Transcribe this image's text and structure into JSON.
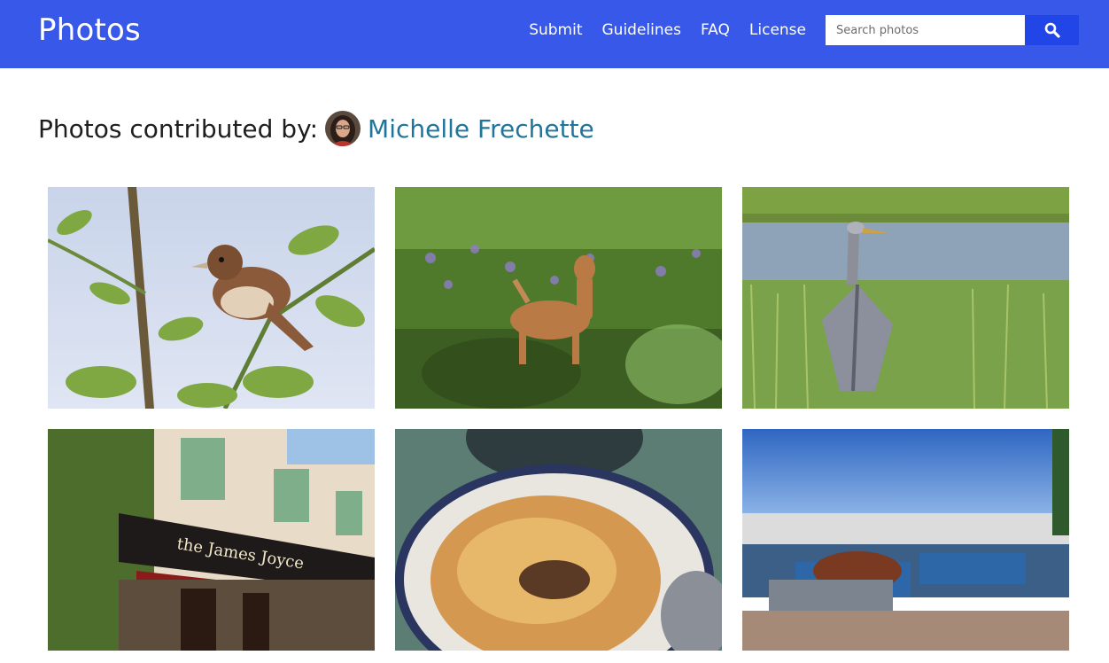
{
  "header": {
    "brand": "Photos",
    "nav": [
      {
        "label": "Submit"
      },
      {
        "label": "Guidelines"
      },
      {
        "label": "FAQ"
      },
      {
        "label": "License"
      }
    ],
    "search": {
      "placeholder": "Search photos",
      "value": "",
      "button_icon": "search-icon"
    }
  },
  "page": {
    "title_prefix": "Photos contributed by:",
    "contributor_name": "Michelle Frechette",
    "avatar_icon": "avatar"
  },
  "photos": [
    {
      "subject": "sparrow-photo"
    },
    {
      "subject": "deer-photo"
    },
    {
      "subject": "heron-photo"
    },
    {
      "subject": "pub-photo"
    },
    {
      "subject": "food-photo"
    },
    {
      "subject": "harbor-photo"
    }
  ],
  "colors": {
    "header_bg": "#3858e9",
    "search_button_bg": "#2145e6",
    "link": "#21759b",
    "text": "#1e1e1e"
  }
}
